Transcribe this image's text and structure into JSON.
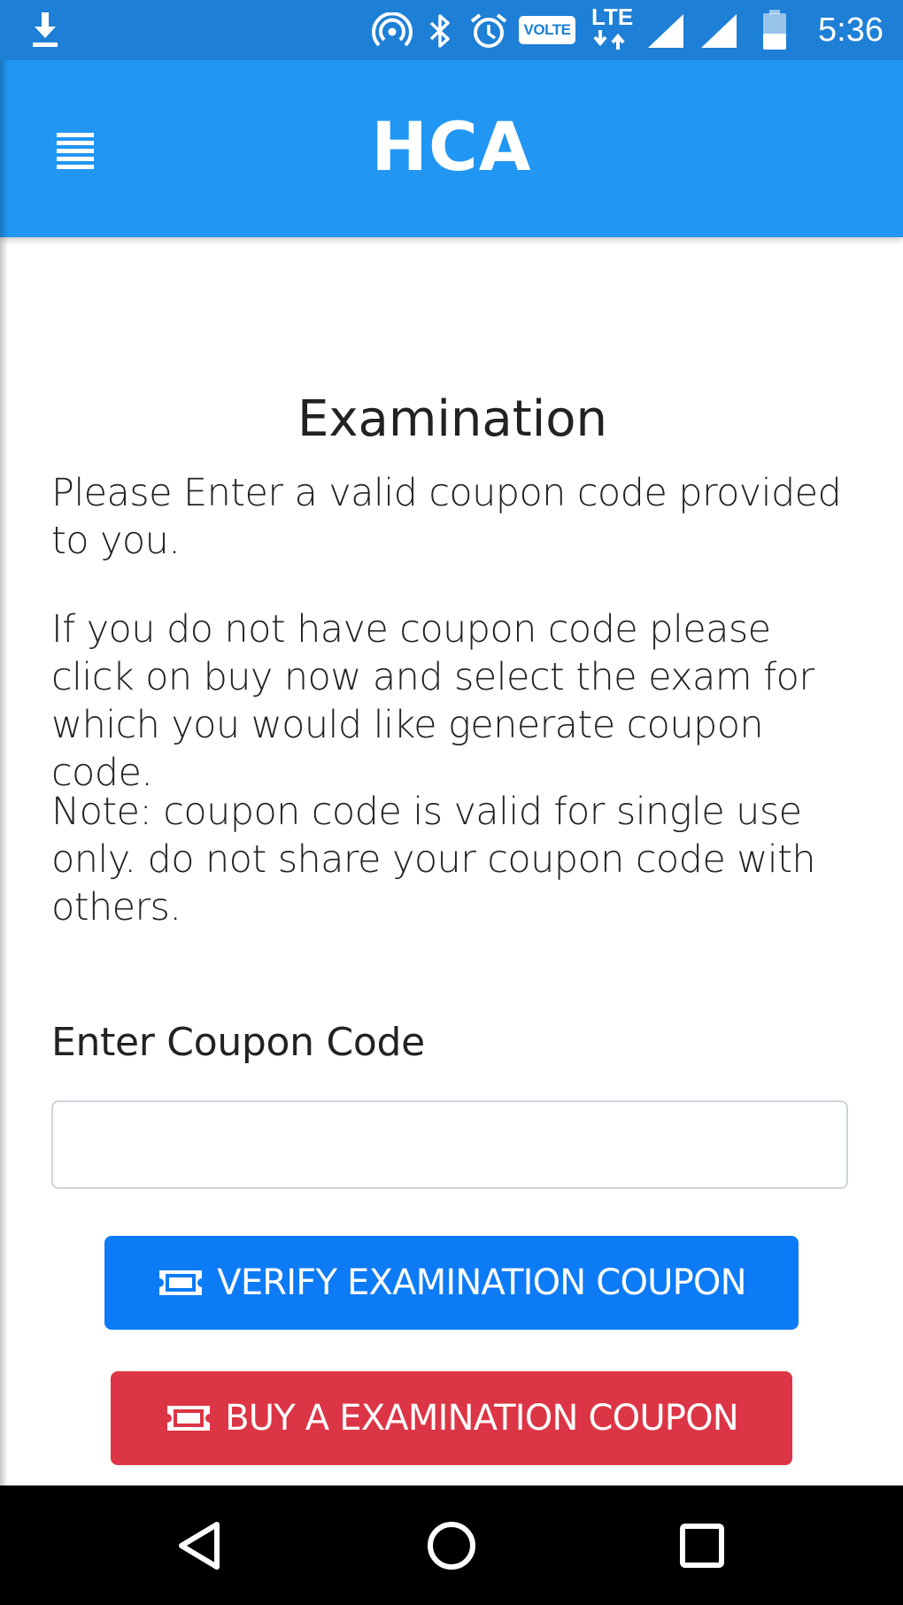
{
  "status_bar": {
    "time": "5:36",
    "volte_label": "VOLTE",
    "lte_label": "LTE",
    "icons": [
      "download-icon",
      "hotspot-icon",
      "bluetooth-icon",
      "alarm-icon",
      "volte-icon",
      "lte-icon",
      "signal-icon",
      "signal-icon",
      "battery-icon"
    ],
    "bg_color": "#1e7fd6"
  },
  "app_bar": {
    "title": "HCA",
    "menu_icon": "menu-icon",
    "bg_color": "#2196f3"
  },
  "content": {
    "title": "Examination",
    "paragraph_1": "Please Enter a valid coupon code provided to you.",
    "paragraph_2": "If you do not have coupon code please click on buy now and select the exam for which you would like generate coupon code.",
    "paragraph_3": "Note: coupon code is valid for single use only. do not share your coupon code with others.",
    "coupon_label": "Enter Coupon Code",
    "coupon_value": "",
    "verify_button": "VERIFY EXAMINATION COUPON",
    "buy_button": "BUY A EXAMINATION COUPON",
    "button_icon": "ticket-icon",
    "verify_color": "#0d7bf5",
    "buy_color": "#dc3545"
  },
  "nav_bar": {
    "icons": [
      "back-icon",
      "home-icon",
      "recents-icon"
    ]
  }
}
